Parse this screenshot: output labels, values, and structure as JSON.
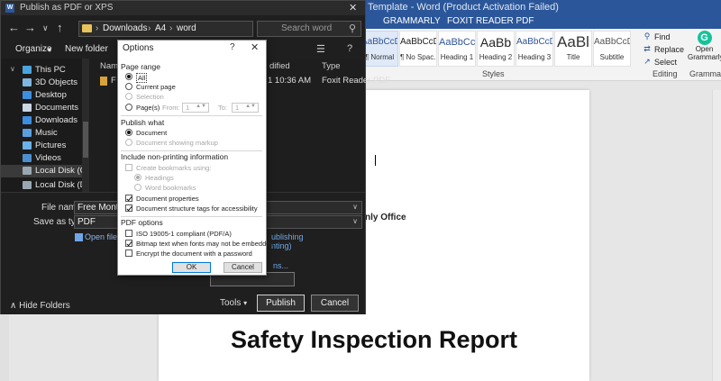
{
  "word": {
    "title": "Template - Word (Product Activation Failed)",
    "tabs": [
      "GRAMMARLY",
      "FOXIT READER PDF"
    ],
    "styles": [
      {
        "sample": "AaBbCcDc",
        "name": "¶ Normal"
      },
      {
        "sample": "AaBbCcDc",
        "name": "¶ No Spac..."
      },
      {
        "sample": "AaBbCc",
        "name": "Heading 1"
      },
      {
        "sample": "AaBb",
        "name": "Heading 2"
      },
      {
        "sample": "AaBbCcD",
        "name": "Heading 3"
      },
      {
        "sample": "AaBl",
        "name": "Title"
      },
      {
        "sample": "AaBbCcD",
        "name": "Subtitle"
      }
    ],
    "styles_label": "Styles",
    "editing": {
      "find": "Find",
      "replace": "Replace",
      "select": "Select",
      "label": "Editing"
    },
    "grammarly": {
      "line1": "Open",
      "line2": "Grammarly",
      "label": "Grammarly"
    },
    "doc_fragment": "nly Office",
    "doc_heading": "Safety Inspection Report"
  },
  "publish": {
    "title": "Publish as PDF or XPS",
    "breadcrumb": [
      "Downloads",
      "A4",
      "word"
    ],
    "search_placeholder": "Search word",
    "organize": "Organize",
    "new_folder": "New folder",
    "sidebar": [
      "This PC",
      "3D Objects",
      "Desktop",
      "Documents",
      "Downloads",
      "Music",
      "Pictures",
      "Videos",
      "Local Disk (C:)",
      "Local Disk (D:)"
    ],
    "columns": {
      "name": "Name",
      "modified": "dified",
      "type": "Type"
    },
    "file": {
      "name": "F",
      "modified": "1 10:36 AM",
      "type": "Foxit Reader PDF"
    },
    "file_name_label": "File name:",
    "file_name_value": "Free Monthly",
    "save_type_label": "Save as type:",
    "save_type_value": "PDF",
    "open_after": "Open file af",
    "right_links": [
      "ublishing",
      "nting)"
    ],
    "options_link": "ns...",
    "hide_folders": "Hide Folders",
    "tools": "Tools",
    "publish_btn": "Publish",
    "cancel_btn": "Cancel",
    "colors": {
      "accent": "#2b579a",
      "dark_bg": "#1f1f1f"
    }
  },
  "options": {
    "title": "Options",
    "page_range": "Page range",
    "all": "All",
    "current_page": "Current page",
    "selection": "Selection",
    "pages": "Page(s)",
    "from": "From:",
    "from_value": "1",
    "to": "To:",
    "to_value": "1",
    "publish_what": "Publish what",
    "document": "Document",
    "doc_markup": "Document showing markup",
    "include": "Include non-printing information",
    "create_bookmarks": "Create bookmarks using:",
    "headings": "Headings",
    "word_bookmarks": "Word bookmarks",
    "doc_props": "Document properties",
    "struct_tags": "Document structure tags for accessibility",
    "pdf_options": "PDF options",
    "iso": "ISO 19005-1 compliant (PDF/A)",
    "bitmap": "Bitmap text when fonts may not be embedded",
    "encrypt": "Encrypt the document with a password",
    "ok": "OK",
    "cancel": "Cancel"
  }
}
